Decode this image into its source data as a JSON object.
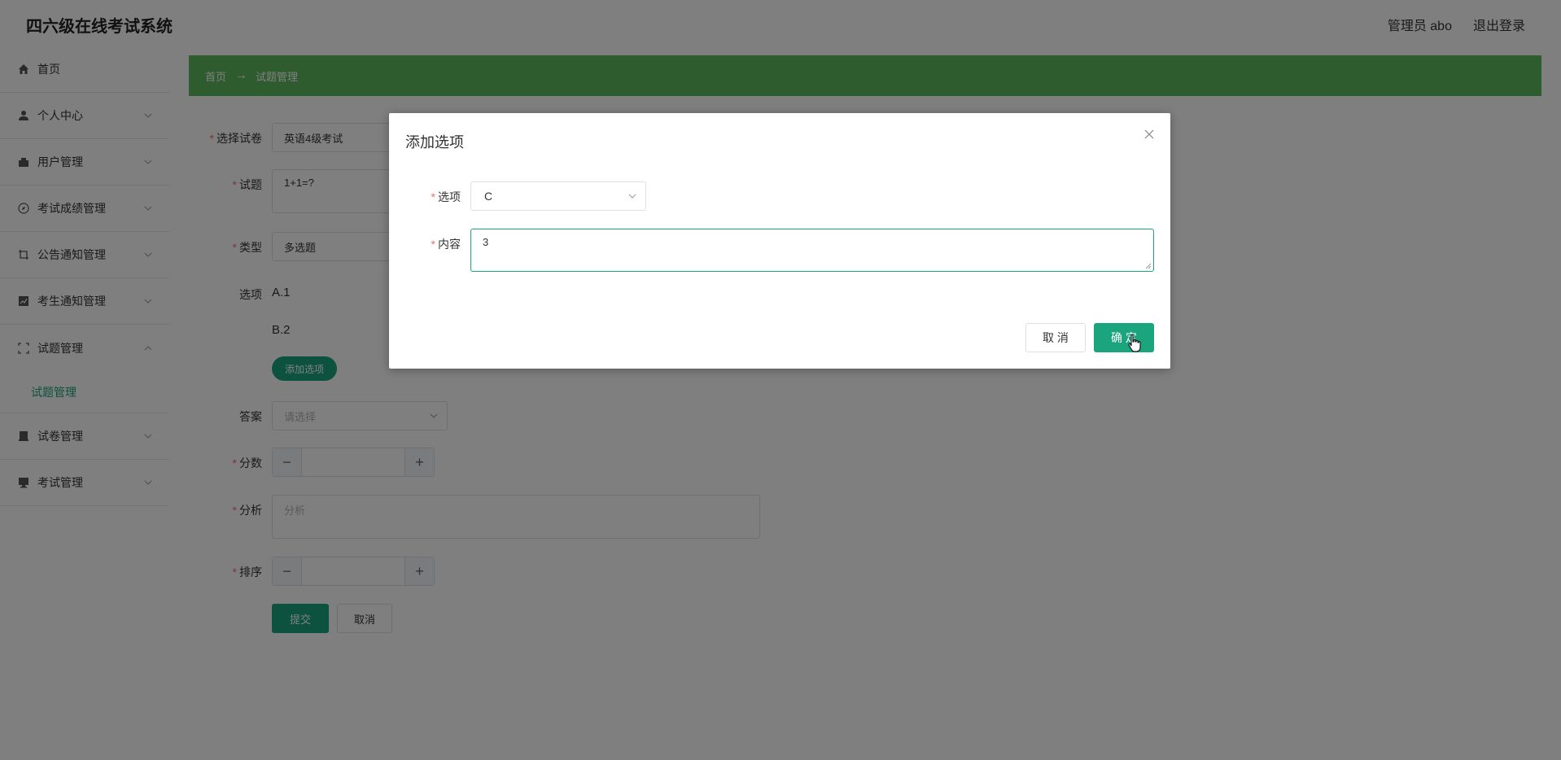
{
  "header": {
    "app_title": "四六级在线考试系统",
    "user_label": "管理员 abo",
    "logout_label": "退出登录"
  },
  "sidebar": {
    "items": [
      {
        "label": "首页",
        "icon": "home-icon"
      },
      {
        "label": "个人中心",
        "icon": "user-icon"
      },
      {
        "label": "用户管理",
        "icon": "users-icon"
      },
      {
        "label": "考试成绩管理",
        "icon": "compass-icon"
      },
      {
        "label": "公告通知管理",
        "icon": "crop-icon"
      },
      {
        "label": "考生通知管理",
        "icon": "chart-icon"
      },
      {
        "label": "试题管理",
        "icon": "fullscreen-icon"
      },
      {
        "label": "试卷管理",
        "icon": "document-icon"
      },
      {
        "label": "考试管理",
        "icon": "monitor-icon"
      }
    ],
    "active_submenu": "试题管理"
  },
  "breadcrumb": {
    "home": "首页",
    "separator": "→",
    "current": "试题管理"
  },
  "form": {
    "paper_label": "选择试卷",
    "paper_value": "英语4级考试",
    "question_label": "试题",
    "question_value": "1+1=?",
    "type_label": "类型",
    "type_value": "多选题",
    "options_label": "选项",
    "options": [
      "A.1",
      "B.2"
    ],
    "add_option_button": "添加选项",
    "answer_label": "答案",
    "answer_placeholder": "请选择",
    "score_label": "分数",
    "analysis_label": "分析",
    "analysis_placeholder": "分析",
    "sort_label": "排序",
    "submit_button": "提交",
    "cancel_button": "取消",
    "required_mark": "*",
    "minus": "−",
    "plus": "+"
  },
  "dialog": {
    "title": "添加选项",
    "option_label": "选项",
    "option_value": "C",
    "content_label": "内容",
    "content_value": "3",
    "cancel_button": "取 消",
    "confirm_button": "确 定"
  },
  "colors": {
    "accent": "#1aa57f",
    "breadcrumb_bg": "#5fb85f",
    "required": "#f56c6c"
  }
}
